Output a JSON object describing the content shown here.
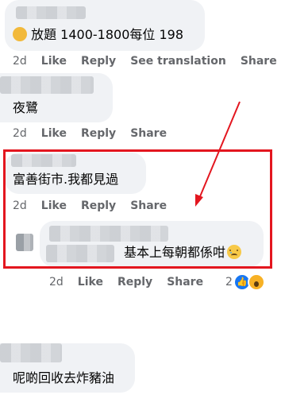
{
  "comments": [
    {
      "text": "放題 1400-1800每位 198",
      "actions": {
        "time": "2d",
        "like": "Like",
        "reply": "Reply",
        "translate": "See translation",
        "share": "Share"
      }
    },
    {
      "text": "夜鷺",
      "actions": {
        "time": "2d",
        "like": "Like",
        "reply": "Reply",
        "share": "Share"
      }
    },
    {
      "text": "富善街市.我都見過",
      "actions": {
        "time": "2d",
        "like": "Like",
        "reply": "Reply",
        "share": "Share"
      }
    },
    {
      "text": "基本上每朝都係咁",
      "actions": {
        "time": "2d",
        "like": "Like",
        "reply": "Reply",
        "share": "Share"
      },
      "reaction_count": "2"
    },
    {
      "text": "呢啲回收去炸豬油"
    }
  ],
  "colors": {
    "highlight": "#e3161f",
    "bubble": "#f0f2f5",
    "meta": "#65676b",
    "like_blue": "#1877f2"
  }
}
